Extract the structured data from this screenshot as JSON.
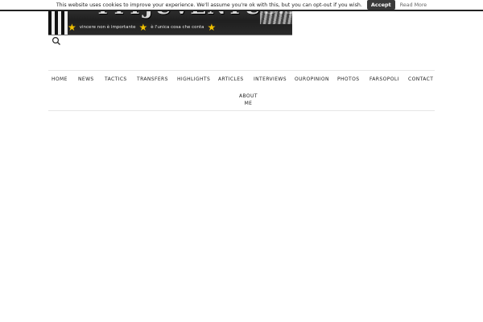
{
  "cookie_bar": {
    "message": "This website uses cookies to improve your experience. We'll assume you're ok with this, but you can opt-out if you wish.",
    "accept_label": "Accept",
    "read_more_label": "Read More"
  },
  "banner": {
    "site_title": "TYTJUVENTUS.NET",
    "slogan_left": "vincere non è importante",
    "slogan_right": "è l'unica cosa che conta"
  },
  "nav": {
    "items": [
      {
        "label": "HOME"
      },
      {
        "label": "NEWS"
      },
      {
        "label": "TACTICS"
      },
      {
        "label": "TRANSFERS"
      },
      {
        "label": "HIGHLIGHTS"
      },
      {
        "label": "ARTICLES"
      },
      {
        "label": "INTERVIEWS"
      },
      {
        "label": "OUROPINION"
      },
      {
        "label": "PHOTOS"
      },
      {
        "label": "FARSOPOLI"
      },
      {
        "label": "CONTACT"
      }
    ],
    "about_line1": "ABOUT",
    "about_line2": "ME"
  },
  "icons": {
    "search": "search-icon",
    "star": "star-icon"
  },
  "colors": {
    "cookie_border": "#222222",
    "accept_bg": "#3a3a3a",
    "banner_bg": "#2a2a2a",
    "star": "#f2c200"
  }
}
